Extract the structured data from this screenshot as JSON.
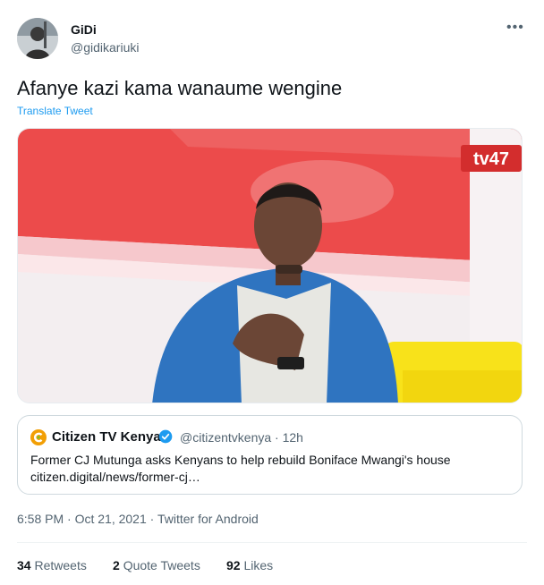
{
  "author": {
    "name": "GiDi",
    "handle": "@gidikariuki",
    "avatar_icon": "profile-photo"
  },
  "more_icon": "more-horizontal-icon",
  "tweet_text": "Afanye kazi kama wanaume wengine",
  "translate_label": "Translate Tweet",
  "media": {
    "logo_text": "tv47"
  },
  "quoted": {
    "name": "Citizen TV Kenya",
    "handle": "@citizentvkenya",
    "separator": "·",
    "time": "12h",
    "text": "Former CJ Mutunga asks Kenyans to help rebuild Boniface Mwangi's house",
    "link": "citizen.digital/news/former-cj…"
  },
  "meta": {
    "time": "6:58 PM",
    "separator1": "·",
    "date": "Oct 21, 2021",
    "separator2": "·",
    "source": "Twitter for Android"
  },
  "stats": {
    "retweets_count": "34",
    "retweets_label": "Retweets",
    "quotes_count": "2",
    "quotes_label": "Quote Tweets",
    "likes_count": "92",
    "likes_label": "Likes"
  },
  "colors": {
    "accent": "#1d9bf0",
    "secondary_text": "#536471",
    "border": "#cfd9de"
  }
}
